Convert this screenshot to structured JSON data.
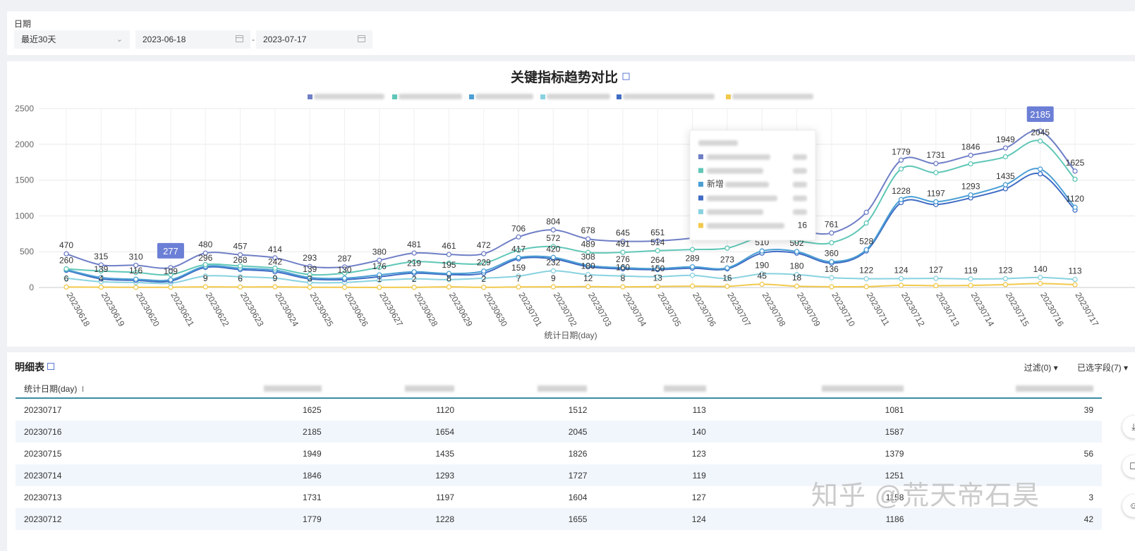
{
  "filters": {
    "date_label": "日期",
    "range_value": "最近30天",
    "start_date": "2023-06-18",
    "separator": "-",
    "end_date": "2023-07-17"
  },
  "chart_data": {
    "type": "line",
    "title": "关键指标趋势对比",
    "xlabel": "统计日期(day)",
    "ylabel": "",
    "ylim": [
      0,
      2500
    ],
    "yticks": [
      0,
      500,
      1000,
      1500,
      2000,
      2500
    ],
    "grid": true,
    "legend_position": "top",
    "categories": [
      "20230618",
      "20230619",
      "20230620",
      "20230621",
      "20230622",
      "20230623",
      "20230624",
      "20230625",
      "20230626",
      "20230627",
      "20230628",
      "20230629",
      "20230630",
      "20230701",
      "20230702",
      "20230703",
      "20230704",
      "20230705",
      "20230706",
      "20230707",
      "20230708",
      "20230709",
      "20230710",
      "20230711",
      "20230712",
      "20230713",
      "20230714",
      "20230715",
      "20230716",
      "20230717"
    ],
    "series": [
      {
        "color": "#6f7fc6",
        "values": [
          470,
          315,
          310,
          277,
          480,
          457,
          414,
          293,
          287,
          380,
          481,
          461,
          472,
          706,
          804,
          678,
          645,
          651,
          690,
          770,
          850,
          800,
          761,
          1050,
          1779,
          1731,
          1846,
          1949,
          2185,
          1625
        ]
      },
      {
        "color": "#5fc7b7",
        "values": [
          260,
          230,
          210,
          180,
          320,
          300,
          270,
          180,
          200,
          280,
          360,
          340,
          340,
          520,
          572,
          489,
          491,
          514,
          530,
          550,
          700,
          650,
          625,
          900,
          1655,
          1604,
          1727,
          1826,
          2045,
          1512
        ]
      },
      {
        "color": "#4b9fd5",
        "values": [
          250,
          139,
          116,
          109,
          296,
          268,
          242,
          139,
          130,
          176,
          219,
          195,
          229,
          417,
          420,
          308,
          276,
          264,
          289,
          273,
          510,
          502,
          360,
          528,
          1228,
          1197,
          1293,
          1435,
          1654,
          1120
        ]
      },
      {
        "color": "#88d2e0",
        "values": [
          130,
          80,
          70,
          60,
          160,
          150,
          130,
          70,
          70,
          100,
          120,
          110,
          130,
          159,
          232,
          180,
          160,
          150,
          170,
          125,
          190,
          180,
          136,
          122,
          124,
          127,
          119,
          123,
          140,
          113
        ]
      },
      {
        "color": "#3f6cc4",
        "values": [
          240,
          120,
          100,
          90,
          280,
          250,
          220,
          120,
          110,
          150,
          200,
          180,
          200,
          400,
          400,
          290,
          260,
          250,
          270,
          260,
          480,
          480,
          340,
          510,
          1186,
          1158,
          1251,
          1379,
          1587,
          1081
        ]
      },
      {
        "color": "#f2c94c",
        "values": [
          6,
          4,
          2,
          3,
          9,
          6,
          9,
          3,
          2,
          1,
          2,
          8,
          2,
          7,
          9,
          12,
          8,
          13,
          19,
          16,
          45,
          18,
          10,
          12,
          30,
          25,
          28,
          40,
          55,
          39
        ]
      }
    ],
    "data_labels": [
      {
        "series": 0,
        "points": [
          0,
          1,
          2,
          4,
          5,
          6,
          7,
          8,
          9,
          10,
          11,
          12,
          13,
          14,
          15,
          16,
          17,
          22,
          24,
          25,
          26,
          27,
          29
        ]
      },
      {
        "series": 1,
        "points": [
          0,
          14,
          15,
          16,
          17,
          28
        ]
      },
      {
        "series": 2,
        "points": [
          1,
          2,
          3,
          4,
          5,
          6,
          7,
          8,
          9,
          10,
          11,
          12,
          13,
          14,
          15,
          16,
          17,
          18,
          19,
          20,
          21,
          22,
          23,
          24,
          25,
          26,
          27,
          29
        ]
      },
      {
        "series": 3,
        "points": [
          13,
          14,
          15,
          16,
          17,
          20,
          21,
          22,
          23,
          24,
          25,
          26,
          27,
          28,
          29
        ]
      },
      {
        "series": 5,
        "points": [
          0,
          1,
          4,
          5,
          6,
          7,
          9,
          10,
          11,
          12,
          13,
          14,
          15,
          16,
          17,
          19,
          20,
          21
        ]
      }
    ],
    "highlights": [
      {
        "series": 0,
        "point": 3,
        "label": "277"
      },
      {
        "series": 0,
        "point": 28,
        "label": "2185"
      }
    ],
    "tooltip": {
      "partial_value": "16",
      "partial_label": "新增"
    }
  },
  "table": {
    "title": "明细表",
    "filter_label": "过滤(0)",
    "fields_label": "已选字段(7)",
    "first_col_header": "统计日期(day)",
    "rows": [
      [
        "20230717",
        "1625",
        "1120",
        "1512",
        "113",
        "1081",
        "39"
      ],
      [
        "20230716",
        "2185",
        "1654",
        "2045",
        "140",
        "1587",
        ""
      ],
      [
        "20230715",
        "1949",
        "1435",
        "1826",
        "123",
        "1379",
        "56"
      ],
      [
        "20230714",
        "1846",
        "1293",
        "1727",
        "119",
        "1251",
        ""
      ],
      [
        "20230713",
        "1731",
        "1197",
        "1604",
        "127",
        "1158",
        "3"
      ],
      [
        "20230712",
        "1779",
        "1228",
        "1655",
        "124",
        "1186",
        "42"
      ]
    ]
  },
  "brand_watermark": "知乎 @荒天帝石昊"
}
